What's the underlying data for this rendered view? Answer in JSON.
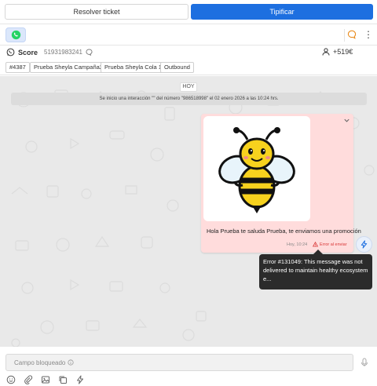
{
  "header": {
    "resolver_label": "Resolver ticket",
    "tipificar_label": "Tipificar"
  },
  "channel": {
    "kebab": "⋮",
    "icons": [
      "whatsapp-icon",
      "chat-bubble-icon",
      "kebab-menu-icon"
    ]
  },
  "contact": {
    "score_label": "Score",
    "phone": "51931983241",
    "right_phone": "+519€"
  },
  "tags": [
    "#4387",
    "Prueba Sheyla Campaña2",
    "Prueba Sheyla Cola 1",
    "Outbound"
  ],
  "chat": {
    "day_label": "HOY",
    "system_message": "Se inicio una interacción \"\" del número \"986518998\" el 02 enero 2026 a las 10:24 hrs.",
    "message": {
      "text": "Hola Prueba te saluda Prueba, te enviamos una promoción",
      "time": "Hoy, 10:24",
      "status": "Error al enviar",
      "image": "bee-illustration"
    },
    "tooltip": "Error #131049: This message was not delivered to maintain healthy ecosystem e..."
  },
  "input": {
    "placeholder": "Campo bloqueado",
    "toolbar_icons": [
      "emoji-icon",
      "attach-icon",
      "image-icon",
      "copy-icon",
      "bolt-icon"
    ]
  },
  "colors": {
    "primary": "#1d6fe0",
    "bubble": "#ffdcdc",
    "error": "#d93636",
    "whatsapp": "#25d366",
    "tooltip_bg": "#2b2b2b"
  }
}
